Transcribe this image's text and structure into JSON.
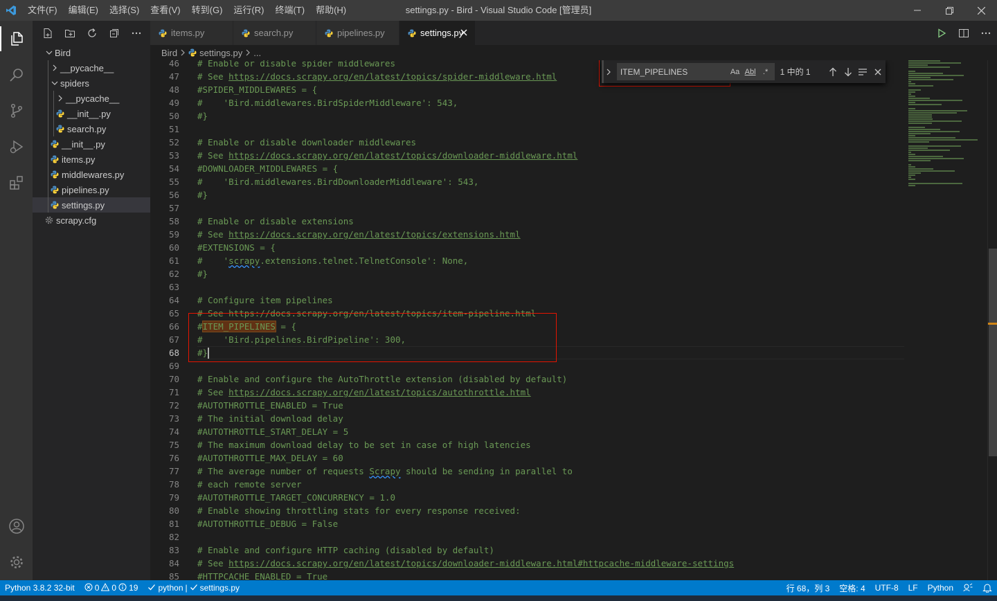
{
  "window": {
    "title": "settings.py - Bird - Visual Studio Code [管理员]",
    "menu": [
      "文件(F)",
      "编辑(E)",
      "选择(S)",
      "查看(V)",
      "转到(G)",
      "运行(R)",
      "终端(T)",
      "帮助(H)"
    ]
  },
  "sidebar": {
    "root": "Bird",
    "items": [
      {
        "label": "__pycache__",
        "type": "folder",
        "expanded": false
      },
      {
        "label": "spiders",
        "type": "folder",
        "expanded": true
      },
      {
        "label": "__pycache__",
        "type": "folder",
        "expanded": false
      },
      {
        "label": "__init__.py",
        "type": "python"
      },
      {
        "label": "search.py",
        "type": "python"
      },
      {
        "label": "__init__.py",
        "type": "python"
      },
      {
        "label": "items.py",
        "type": "python"
      },
      {
        "label": "middlewares.py",
        "type": "python"
      },
      {
        "label": "pipelines.py",
        "type": "python"
      },
      {
        "label": "settings.py",
        "type": "python",
        "selected": true
      },
      {
        "label": "scrapy.cfg",
        "type": "config"
      }
    ]
  },
  "tabs": [
    {
      "label": "items.py",
      "active": false
    },
    {
      "label": "search.py",
      "active": false
    },
    {
      "label": "pipelines.py",
      "active": false
    },
    {
      "label": "settings.py",
      "active": true
    }
  ],
  "breadcrumb": {
    "folder": "Bird",
    "file": "settings.py",
    "more": "..."
  },
  "find": {
    "query": "ITEM_PIPELINES",
    "opt_case": "Aa",
    "opt_word": "Abl",
    "opt_regex": ".*",
    "count": "1 中的 1"
  },
  "code_lines": [
    {
      "n": "46",
      "text": "# Enable or disable spider middlewares"
    },
    {
      "n": "47",
      "pre": "# See ",
      "link": "https://docs.scrapy.org/en/latest/topics/spider-middleware.html"
    },
    {
      "n": "48",
      "text": "#SPIDER_MIDDLEWARES = {"
    },
    {
      "n": "49",
      "text": "#    'Bird.middlewares.BirdSpiderMiddleware': 543,"
    },
    {
      "n": "50",
      "text": "#}"
    },
    {
      "n": "51",
      "text": ""
    },
    {
      "n": "52",
      "text": "# Enable or disable downloader middlewares"
    },
    {
      "n": "53",
      "pre": "# See ",
      "link": "https://docs.scrapy.org/en/latest/topics/downloader-middleware.html"
    },
    {
      "n": "54",
      "text": "#DOWNLOADER_MIDDLEWARES = {"
    },
    {
      "n": "55",
      "text": "#    'Bird.middlewares.BirdDownloaderMiddleware': 543,"
    },
    {
      "n": "56",
      "text": "#}"
    },
    {
      "n": "57",
      "text": ""
    },
    {
      "n": "58",
      "text": "# Enable or disable extensions"
    },
    {
      "n": "59",
      "pre": "# See ",
      "link": "https://docs.scrapy.org/en/latest/topics/extensions.html"
    },
    {
      "n": "60",
      "text": "#EXTENSIONS = {"
    },
    {
      "n": "61",
      "pre": "#    '",
      "squiggle": "scrapy",
      "post": ".extensions.telnet.TelnetConsole': None,"
    },
    {
      "n": "62",
      "text": "#}"
    },
    {
      "n": "63",
      "text": ""
    },
    {
      "n": "64",
      "text": "# Configure item pipelines"
    },
    {
      "n": "65",
      "text": "# See https://docs.scrapy.org/en/latest/topics/item-pipeline.html"
    },
    {
      "n": "66",
      "pre": "#",
      "match": "ITEM_PIPELINES",
      "post": " = {"
    },
    {
      "n": "67",
      "text": "#    'Bird.pipelines.BirdPipeline': 300,"
    },
    {
      "n": "68",
      "text": "#}",
      "current": true
    },
    {
      "n": "69",
      "text": ""
    },
    {
      "n": "70",
      "text": "# Enable and configure the AutoThrottle extension (disabled by default)"
    },
    {
      "n": "71",
      "pre": "# See ",
      "link": "https://docs.scrapy.org/en/latest/topics/autothrottle.html"
    },
    {
      "n": "72",
      "text": "#AUTOTHROTTLE_ENABLED = True"
    },
    {
      "n": "73",
      "text": "# The initial download delay"
    },
    {
      "n": "74",
      "text": "#AUTOTHROTTLE_START_DELAY = 5"
    },
    {
      "n": "75",
      "text": "# The maximum download delay to be set in case of high latencies"
    },
    {
      "n": "76",
      "text": "#AUTOTHROTTLE_MAX_DELAY = 60"
    },
    {
      "n": "77",
      "pre": "# The average number of requests ",
      "squiggle": "Scrapy",
      "post": " should be sending in parallel to"
    },
    {
      "n": "78",
      "text": "# each remote server"
    },
    {
      "n": "79",
      "text": "#AUTOTHROTTLE_TARGET_CONCURRENCY = 1.0"
    },
    {
      "n": "80",
      "text": "# Enable showing throttling stats for every response received:"
    },
    {
      "n": "81",
      "text": "#AUTOTHROTTLE_DEBUG = False"
    },
    {
      "n": "82",
      "text": ""
    },
    {
      "n": "83",
      "text": "# Enable and configure HTTP caching (disabled by default)"
    },
    {
      "n": "84",
      "pre": "# See ",
      "link": "https://docs.scrapy.org/en/latest/topics/downloader-middleware.html#httpcache-middleware-settings"
    },
    {
      "n": "85",
      "text": "#HTTPCACHE_ENABLED = True"
    }
  ],
  "statusbar": {
    "interpreter": "Python 3.8.2 32-bit",
    "errors": "0",
    "warnings": "0",
    "info": "19",
    "run_python": "python",
    "run_sep": "|",
    "run_file": "settings.py",
    "position": "行 68，列 3",
    "spaces": "空格: 4",
    "encoding": "UTF-8",
    "eol": "LF",
    "language": "Python"
  },
  "colors": {
    "accent": "#007acc",
    "comment": "#6a9955",
    "annotation_red": "#e51400",
    "find_match": "#613214"
  }
}
